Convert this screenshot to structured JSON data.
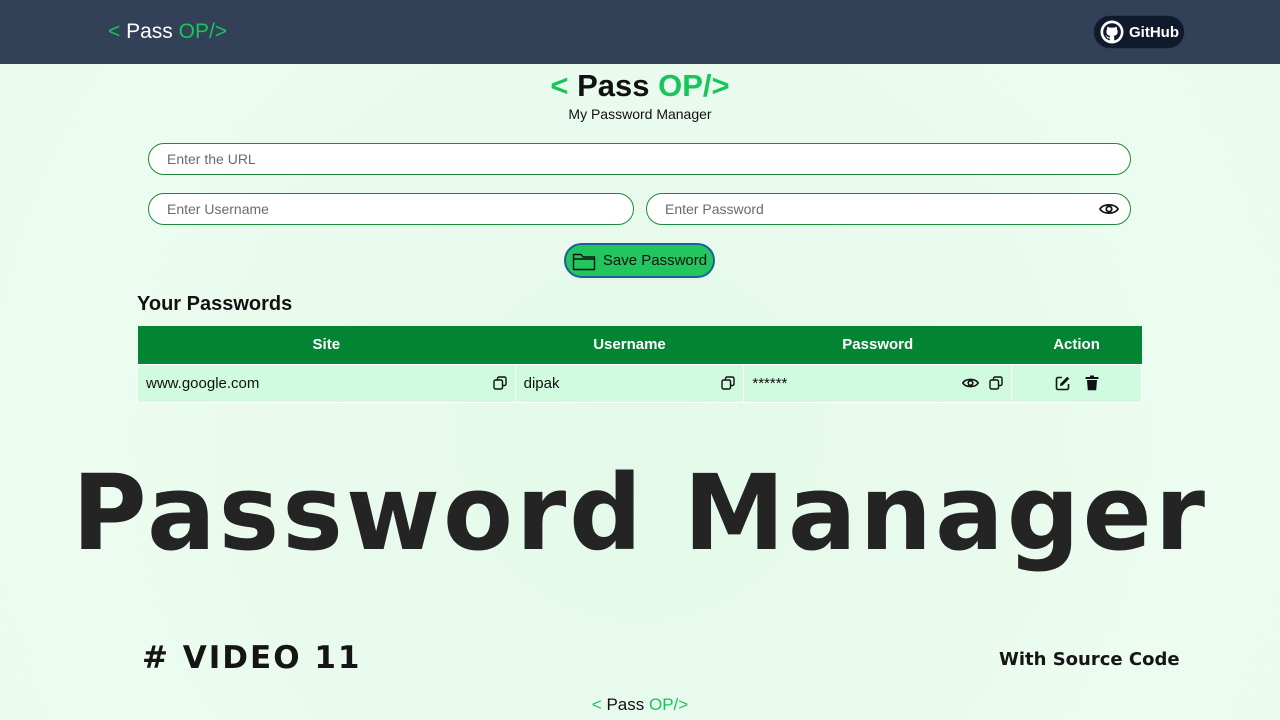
{
  "navbar": {
    "logo_open": "< ",
    "logo_main": "Pass",
    "logo_accent": " OP/>",
    "github_label": "GitHub"
  },
  "header": {
    "logo_open": "< ",
    "logo_main": "Pass",
    "logo_accent": " OP/>",
    "subtitle": "My Password Manager"
  },
  "form": {
    "url_placeholder": "Enter the URL",
    "username_placeholder": "Enter Username",
    "password_placeholder": "Enter Password",
    "save_label": "Save Password"
  },
  "passwords": {
    "heading": "Your Passwords",
    "columns": [
      "Site",
      "Username",
      "Password",
      "Action"
    ],
    "rows": [
      {
        "site": "www.google.com",
        "username": "dipak",
        "password": "******"
      }
    ]
  },
  "banner": {
    "title": "Password Manager",
    "video": "# VIDEO 11",
    "source": "With Source Code"
  },
  "footer": {
    "logo_open": "< ",
    "logo_main": "Pass",
    "logo_accent": " OP/>"
  },
  "colors": {
    "navbar": "#334158",
    "accent": "#19c45a",
    "table_header": "#048534",
    "table_row": "#d0fbe0",
    "save_button": "#22c55e"
  },
  "icons": {
    "github": "github-logo-icon",
    "eye": "eye-icon",
    "folder": "folder-icon",
    "copy": "copy-icon",
    "edit": "edit-icon",
    "delete": "trash-icon"
  }
}
